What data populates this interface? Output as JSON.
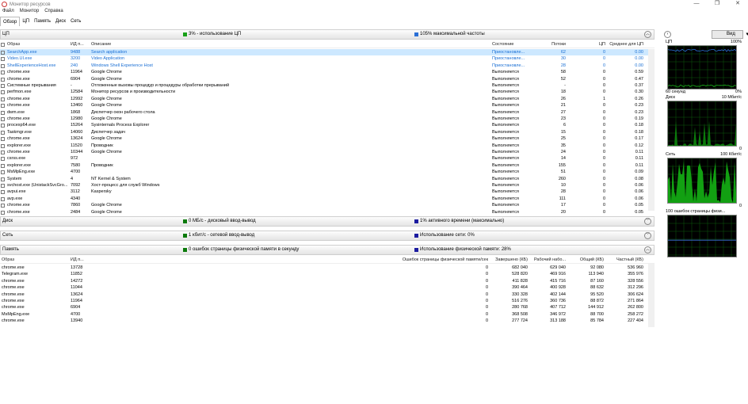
{
  "window": {
    "title": "Монитор ресурсов",
    "minimize": "—",
    "maximize": "❐",
    "close": "✕"
  },
  "menu": [
    "Файл",
    "Монитор",
    "Справка"
  ],
  "tabs": [
    "Обзор",
    "ЦП",
    "Память",
    "Диск",
    "Сеть"
  ],
  "cpu": {
    "name": "ЦП",
    "stat1": "3% - использование ЦП",
    "stat2": "105% максимальной частоты",
    "columns": [
      "Образ",
      "ИД п...",
      "Описание",
      "Состояние",
      "Потоки",
      "ЦП",
      "Среднее для ЦП"
    ],
    "rows": [
      [
        "SearchApp.exe",
        "9488",
        "Search application",
        "Приостановле...",
        "62",
        "0",
        "0.00"
      ],
      [
        "Video.UI.exe",
        "3200",
        "Video Application",
        "Приостановле...",
        "30",
        "0",
        "0.00"
      ],
      [
        "ShellExperienceHost.exe",
        "240",
        "Windows Shell Experience Host",
        "Приостановле...",
        "28",
        "0",
        "0.00"
      ],
      [
        "chrome.exe",
        "11964",
        "Google Chrome",
        "Выполняется",
        "58",
        "0",
        "0.59"
      ],
      [
        "chrome.exe",
        "6904",
        "Google Chrome",
        "Выполняется",
        "52",
        "0",
        "0.47"
      ],
      [
        "Системные прерывания",
        "-",
        "Отложенные вызовы процедур и процедуры обработки прерываний",
        "Выполняется",
        "-",
        "0",
        "0.37"
      ],
      [
        "perfmon.exe",
        "12584",
        "Монитор ресурсов и производительности",
        "Выполняется",
        "18",
        "0",
        "0.30"
      ],
      [
        "chrome.exe",
        "12992",
        "Google Chrome",
        "Выполняется",
        "26",
        "1",
        "0.26"
      ],
      [
        "chrome.exe",
        "13460",
        "Google Chrome",
        "Выполняется",
        "21",
        "0",
        "0.23"
      ],
      [
        "dwm.exe",
        "1868",
        "Диспетчер окон рабочего стола",
        "Выполняется",
        "27",
        "0",
        "0.23"
      ],
      [
        "chrome.exe",
        "12980",
        "Google Chrome",
        "Выполняется",
        "23",
        "0",
        "0.19"
      ],
      [
        "procexp64.exe",
        "15264",
        "Sysinternals Process Explorer",
        "Выполняется",
        "6",
        "0",
        "0.18"
      ],
      [
        "Taskmgr.exe",
        "14060",
        "Диспетчер задач",
        "Выполняется",
        "15",
        "0",
        "0.18"
      ],
      [
        "chrome.exe",
        "13624",
        "Google Chrome",
        "Выполняется",
        "25",
        "0",
        "0.17"
      ],
      [
        "explorer.exe",
        "11520",
        "Проводник",
        "Выполняется",
        "35",
        "0",
        "0.12"
      ],
      [
        "chrome.exe",
        "10344",
        "Google Chrome",
        "Выполняется",
        "24",
        "0",
        "0.11"
      ],
      [
        "csrss.exe",
        "972",
        "",
        "Выполняется",
        "14",
        "0",
        "0.11"
      ],
      [
        "explorer.exe",
        "7580",
        "Проводник",
        "Выполняется",
        "155",
        "0",
        "0.11"
      ],
      [
        "MsMpEng.exe",
        "4700",
        "",
        "Выполняется",
        "51",
        "0",
        "0.09"
      ],
      [
        "System",
        "4",
        "NT Kernel & System",
        "Выполняется",
        "260",
        "0",
        "0.08"
      ],
      [
        "svchost.exe (UnistackSvcGro...",
        "7092",
        "Хост-процесс для служб Windows",
        "Выполняется",
        "10",
        "0",
        "0.06"
      ],
      [
        "avpui.exe",
        "3112",
        "Kaspersky",
        "Выполняется",
        "28",
        "0",
        "0.06"
      ],
      [
        "avp.exe",
        "4340",
        "",
        "Выполняется",
        "111",
        "0",
        "0.06"
      ],
      [
        "chrome.exe",
        "7860",
        "Google Chrome",
        "Выполняется",
        "17",
        "0",
        "0.05"
      ],
      [
        "chrome.exe",
        "2484",
        "Google Chrome",
        "Выполняется",
        "20",
        "0",
        "0.05"
      ]
    ]
  },
  "disk": {
    "name": "Диск",
    "stat1": "0 МБ/с - дисковый ввод-вывод",
    "stat2": "1% активного времени (максимально)"
  },
  "net": {
    "name": "Сеть",
    "stat1": "1 кбит/с - сетевой ввод-вывод",
    "stat2": "Использование сети: 0%"
  },
  "mem": {
    "name": "Память",
    "stat1": "0 ошибок страницы физической памяти в секунду",
    "stat2": "Использование физической памяти: 28%",
    "columns": [
      "Образ",
      "ИД п...",
      "Ошибок страницы физической памяти/сек",
      "Завершено (КБ)",
      "Рабочий набо...",
      "Общий (КБ)",
      "Частный (КБ)"
    ],
    "rows": [
      [
        "chrome.exe",
        "13728",
        "0",
        "682 040",
        "629 040",
        "92 080",
        "536 960"
      ],
      [
        "Telegram.exe",
        "11852",
        "0",
        "528 820",
        "469 916",
        "113 940",
        "355 976"
      ],
      [
        "chrome.exe",
        "14272",
        "0",
        "411 828",
        "415 716",
        "87 160",
        "328 556"
      ],
      [
        "chrome.exe",
        "11044",
        "0",
        "390 464",
        "400 928",
        "88 632",
        "312 296"
      ],
      [
        "chrome.exe",
        "13624",
        "0",
        "330 328",
        "402 144",
        "95 520",
        "306 624"
      ],
      [
        "chrome.exe",
        "11964",
        "0",
        "516 276",
        "360 736",
        "88 872",
        "271 864"
      ],
      [
        "chrome.exe",
        "6904",
        "0",
        "280 768",
        "407 712",
        "144 912",
        "262 800"
      ],
      [
        "MsMpEng.exe",
        "4700",
        "0",
        "368 508",
        "346 972",
        "88 700",
        "258 272"
      ],
      [
        "chrome.exe",
        "13940",
        "0",
        "277 724",
        "313 188",
        "85 784",
        "227 404"
      ]
    ]
  },
  "side": {
    "view_label": "Вид",
    "graphs": [
      {
        "name": "ЦП",
        "max": "100%",
        "left": "60 секунд",
        "right": "0%"
      },
      {
        "name": "Диск",
        "max": "10 Мбит/с",
        "left": "",
        "right": "0"
      },
      {
        "name": "Сеть",
        "max": "100 Кбит/с",
        "left": "",
        "right": "0"
      },
      {
        "name": "100 ошибок страницы физи...",
        "max": "",
        "left": "",
        "right": ""
      }
    ]
  },
  "colors": {
    "cpu_green": "#18a018",
    "cpu_blue": "#2a6fd6",
    "disk_green": "#0b7a0b",
    "disk_blue": "#1c1ca0",
    "grid": "#0d5a0d"
  }
}
